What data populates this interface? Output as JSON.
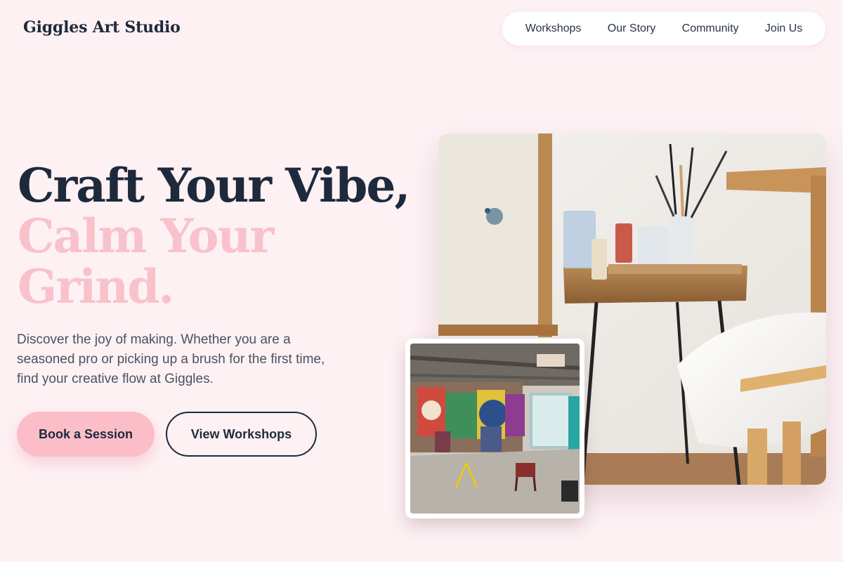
{
  "header": {
    "brand": "Giggles Art Studio",
    "nav": [
      {
        "label": "Workshops"
      },
      {
        "label": "Our Story"
      },
      {
        "label": "Community"
      },
      {
        "label": "Join Us"
      }
    ]
  },
  "hero": {
    "headline_line1": "Craft Your Vibe,",
    "headline_line2": "Calm Your",
    "headline_line3": "Grind.",
    "description": "Discover the joy of making. Whether you are a seasoned pro or picking up a brush for the first time, find your creative flow at Giggles.",
    "primary_cta": "Book a Session",
    "secondary_cta": "View Workshops"
  },
  "images": {
    "main": "art-supplies-stool-photo",
    "inset": "graffiti-studio-photo"
  },
  "colors": {
    "background": "#fdf1f4",
    "dark": "#1e2a3b",
    "accent_pink": "#f9c2cb",
    "button_pink": "#fbbec8"
  }
}
